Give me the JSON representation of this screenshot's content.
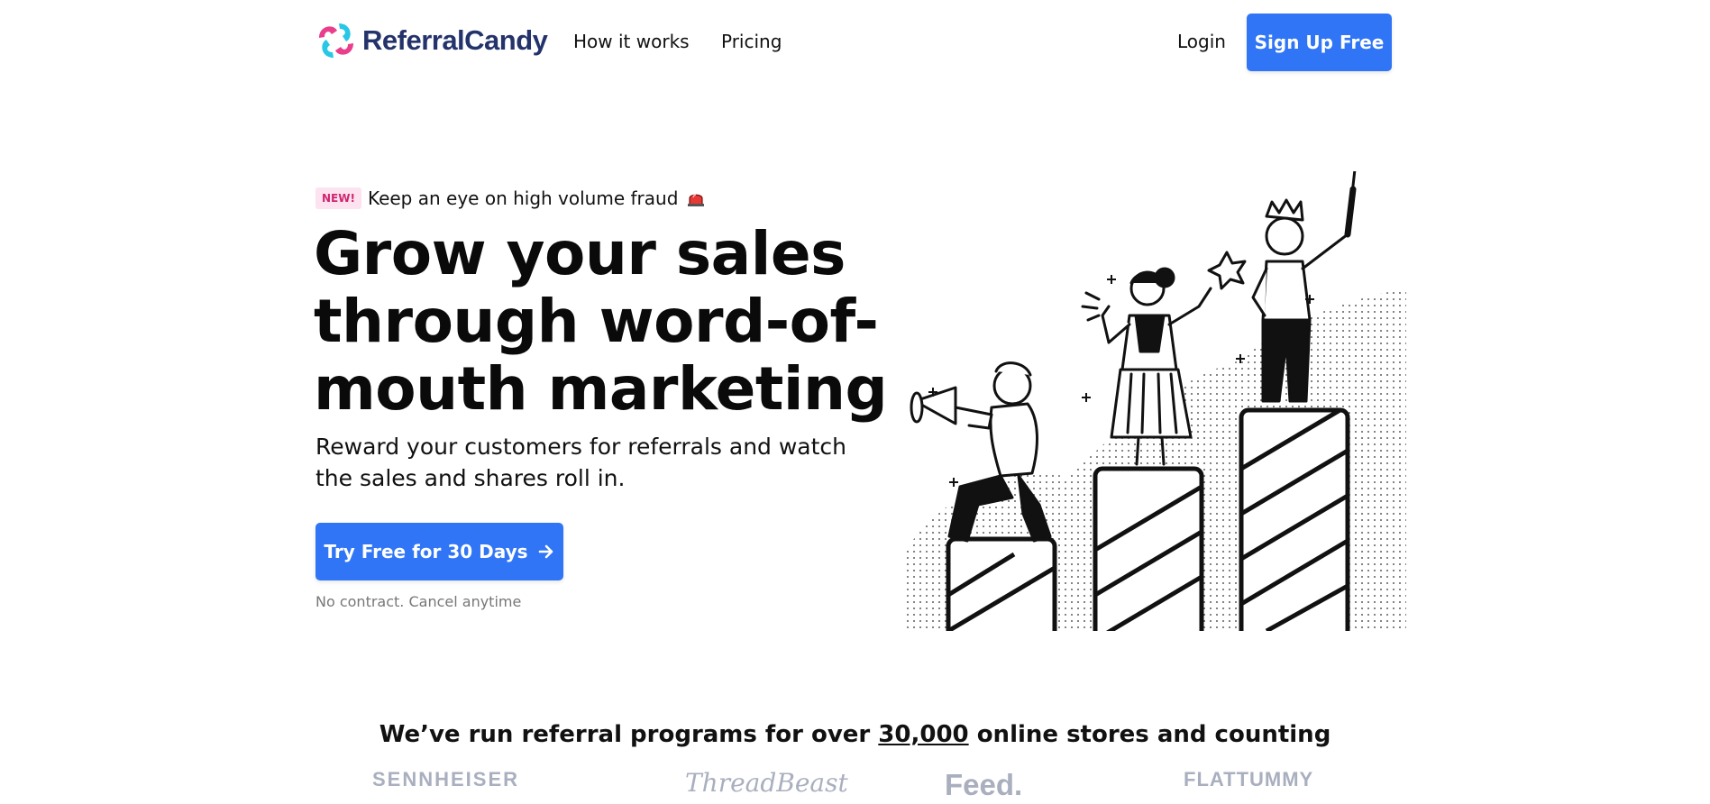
{
  "nav": {
    "brand": "ReferralCandy",
    "links": [
      "How it works",
      "Pricing"
    ],
    "login": "Login",
    "signup": "Sign Up Free"
  },
  "hero": {
    "badge": "NEW!",
    "announcement": "Keep an eye on high volume fraud",
    "headline_lines": [
      "Grow your sales",
      "through word-of-",
      "mouth marketing"
    ],
    "subheadline_lines": [
      "Reward your customers for referrals and watch",
      "the sales and shares roll in."
    ],
    "cta": "Try Free for 30 Days",
    "fine_print": "No contract. Cancel anytime"
  },
  "social_proof": {
    "text_before": "We’ve run referral programs for over ",
    "highlight": "30,000",
    "text_after": " online stores and counting",
    "logos": [
      "SENNHEISER",
      "ThreadBeast",
      "Feed.",
      "FLATTUMMY"
    ]
  },
  "colors": {
    "accent": "#2f75f5",
    "brand_text": "#24336b",
    "badge_bg": "#fde2ef",
    "badge_text": "#d0266f",
    "logo_gray": "#a9afbf"
  }
}
